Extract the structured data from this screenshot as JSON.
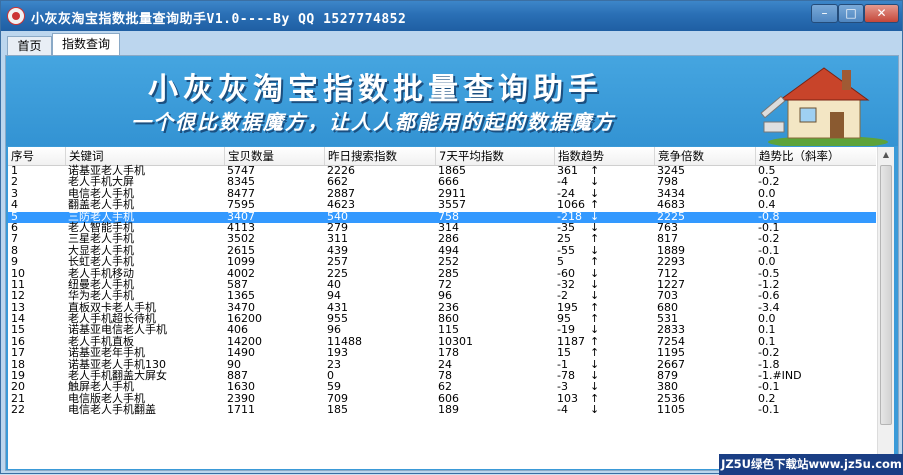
{
  "window": {
    "title": "小灰灰淘宝指数批量查询助手V1.0----By QQ 1527774852",
    "buttons": {
      "minimize": "–",
      "maximize": "□",
      "close": "✕"
    },
    "icon": "app-logo-icon"
  },
  "tabs": [
    {
      "label": "首页"
    },
    {
      "label": "指数查询",
      "active": true
    }
  ],
  "banner": {
    "title": "小灰灰淘宝指数批量查询助手",
    "subtitle": "一个很比数据魔方，让人人都能用的起的数据魔方",
    "image": "house-icon"
  },
  "table": {
    "columns": [
      "序号",
      "关键词",
      "宝贝数量",
      "昨日搜索指数",
      "7天平均指数",
      "指数趋势",
      "竞争倍数",
      "趋势比（斜率）"
    ],
    "selected_row_index": 4,
    "rows": [
      [
        "1",
        "诺基亚老人手机",
        "5747",
        "2226",
        "1865",
        "361",
        "↑",
        "3245",
        "0.5"
      ],
      [
        "2",
        "老人手机大屏",
        "8345",
        "662",
        "666",
        "-4",
        "↓",
        "798",
        "-0.2"
      ],
      [
        "3",
        "电信老人手机",
        "8477",
        "2887",
        "2911",
        "-24",
        "↓",
        "3434",
        "0.0"
      ],
      [
        "4",
        "翻盖老人手机",
        "7595",
        "4623",
        "3557",
        "1066",
        "↑",
        "4683",
        "0.4"
      ],
      [
        "5",
        "三防老人手机",
        "3407",
        "540",
        "758",
        "-218",
        "↓",
        "2225",
        "-0.8"
      ],
      [
        "6",
        "老人智能手机",
        "4113",
        "279",
        "314",
        "-35",
        "↓",
        "763",
        "-0.1"
      ],
      [
        "7",
        "三星老人手机",
        "3502",
        "311",
        "286",
        "25",
        "↑",
        "817",
        "-0.2"
      ],
      [
        "8",
        "大显老人手机",
        "2615",
        "439",
        "494",
        "-55",
        "↓",
        "1889",
        "-0.1"
      ],
      [
        "9",
        "长虹老人手机",
        "1099",
        "257",
        "252",
        "5",
        "↑",
        "2293",
        "0.0"
      ],
      [
        "10",
        "老人手机移动",
        "4002",
        "225",
        "285",
        "-60",
        "↓",
        "712",
        "-0.5"
      ],
      [
        "11",
        "纽曼老人手机",
        "587",
        "40",
        "72",
        "-32",
        "↓",
        "1227",
        "-1.2"
      ],
      [
        "12",
        "华为老人手机",
        "1365",
        "94",
        "96",
        "-2",
        "↓",
        "703",
        "-0.6"
      ],
      [
        "13",
        "直板双卡老人手机",
        "3470",
        "431",
        "236",
        "195",
        "↑",
        "680",
        "-3.4"
      ],
      [
        "14",
        "老人手机超长待机",
        "16200",
        "955",
        "860",
        "95",
        "↑",
        "531",
        "0.0"
      ],
      [
        "15",
        "诺基亚电信老人手机",
        "406",
        "96",
        "115",
        "-19",
        "↓",
        "2833",
        "0.1"
      ],
      [
        "16",
        "老人手机直板",
        "14200",
        "11488",
        "10301",
        "1187",
        "↑",
        "7254",
        "0.1"
      ],
      [
        "17",
        "诺基亚老年手机",
        "1490",
        "193",
        "178",
        "15",
        "↑",
        "1195",
        "-0.2"
      ],
      [
        "18",
        "诺基亚老人手机130",
        "90",
        "23",
        "24",
        "-1",
        "↓",
        "2667",
        "-1.8"
      ],
      [
        "19",
        "老人手机翻盖大屏女",
        "887",
        "0",
        "78",
        "-78",
        "↓",
        "879",
        "-1.#IND"
      ],
      [
        "20",
        "触屏老人手机",
        "1630",
        "59",
        "62",
        "-3",
        "↓",
        "380",
        "-0.1"
      ],
      [
        "21",
        "电信版老人手机",
        "2390",
        "709",
        "606",
        "103",
        "↑",
        "2536",
        "0.2"
      ],
      [
        "22",
        "电信老人手机翻盖",
        "1711",
        "185",
        "189",
        "-4",
        "↓",
        "1105",
        "-0.1"
      ]
    ]
  },
  "scrollbar": {
    "up": "▲",
    "down": "▼"
  },
  "watermark": "JZ5U绿色下载站www.jz5u.com",
  "colors": {
    "selection": "#3399ff",
    "banner": "#3a9ad8",
    "titlebar": "#2a6fb5"
  }
}
